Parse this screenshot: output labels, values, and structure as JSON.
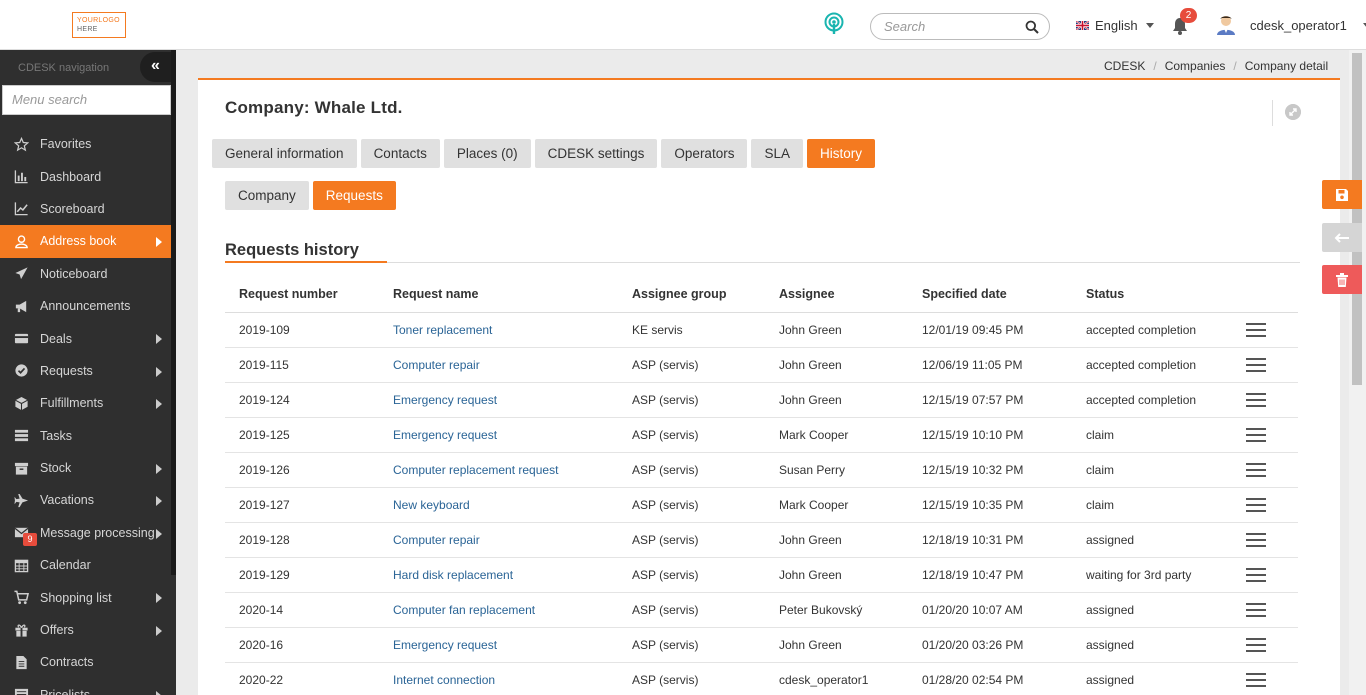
{
  "header": {
    "logo_line1": "YOURLOGO",
    "logo_line2": "HERE",
    "search_placeholder": "Search",
    "language": "English",
    "notifications_count": "2",
    "username": "cdesk_operator1"
  },
  "sidebar": {
    "title": "CDESK navigation",
    "collapse_icon": "«",
    "menu_search_placeholder": "Menu search",
    "items": [
      {
        "label": "Favorites",
        "icon": "star-icon",
        "arrow": false
      },
      {
        "label": "Dashboard",
        "icon": "bar-chart-icon",
        "arrow": false
      },
      {
        "label": "Scoreboard",
        "icon": "line-chart-icon",
        "arrow": false
      },
      {
        "label": "Address book",
        "icon": "user-icon",
        "arrow": true,
        "active": true
      },
      {
        "label": "Noticeboard",
        "icon": "paper-plane-icon",
        "arrow": false
      },
      {
        "label": "Announcements",
        "icon": "bullhorn-icon",
        "arrow": false
      },
      {
        "label": "Deals",
        "icon": "card-icon",
        "arrow": true
      },
      {
        "label": "Requests",
        "icon": "check-circle-icon",
        "arrow": true
      },
      {
        "label": "Fulfillments",
        "icon": "cube-icon",
        "arrow": true
      },
      {
        "label": "Tasks",
        "icon": "tasks-icon",
        "arrow": false
      },
      {
        "label": "Stock",
        "icon": "archive-icon",
        "arrow": true
      },
      {
        "label": "Vacations",
        "icon": "plane-icon",
        "arrow": true
      },
      {
        "label": "Message processing",
        "icon": "envelope-icon",
        "arrow": true,
        "badge": "9"
      },
      {
        "label": "Calendar",
        "icon": "calendar-icon",
        "arrow": false
      },
      {
        "label": "Shopping list",
        "icon": "cart-icon",
        "arrow": true
      },
      {
        "label": "Offers",
        "icon": "gift-icon",
        "arrow": true
      },
      {
        "label": "Contracts",
        "icon": "file-icon",
        "arrow": false
      },
      {
        "label": "Pricelists",
        "icon": "list-icon",
        "arrow": true
      }
    ]
  },
  "breadcrumb": [
    "CDESK",
    "Companies",
    "Company detail"
  ],
  "breadcrumb_sep": "/",
  "page": {
    "title": "Company: Whale Ltd.",
    "tabs": [
      "General information",
      "Contacts",
      "Places (0)",
      "CDESK settings",
      "Operators",
      "SLA",
      "History"
    ],
    "active_tab": "History",
    "subtabs": [
      "Company",
      "Requests"
    ],
    "active_subtab": "Requests",
    "section_title": "Requests history"
  },
  "table": {
    "headers": [
      "Request number",
      "Request name",
      "Assignee group",
      "Assignee",
      "Specified date",
      "Status"
    ],
    "rows": [
      [
        "2019-109",
        "Toner replacement",
        "KE servis",
        "John Green",
        "12/01/19 09:45 PM",
        "accepted completion"
      ],
      [
        "2019-115",
        "Computer repair",
        "ASP (servis)",
        "John Green",
        "12/06/19 11:05 PM",
        "accepted completion"
      ],
      [
        "2019-124",
        "Emergency request",
        "ASP (servis)",
        "John Green",
        "12/15/19 07:57 PM",
        "accepted completion"
      ],
      [
        "2019-125",
        "Emergency request",
        "ASP (servis)",
        "Mark Cooper",
        "12/15/19 10:10 PM",
        "claim"
      ],
      [
        "2019-126",
        "Computer replacement request",
        "ASP (servis)",
        "Susan Perry",
        "12/15/19 10:32 PM",
        "claim"
      ],
      [
        "2019-127",
        "New keyboard",
        "ASP (servis)",
        "Mark Cooper",
        "12/15/19 10:35 PM",
        "claim"
      ],
      [
        "2019-128",
        "Computer repair",
        "ASP (servis)",
        "John Green",
        "12/18/19 10:31 PM",
        "assigned"
      ],
      [
        "2019-129",
        "Hard disk replacement",
        "ASP (servis)",
        "John Green",
        "12/18/19 10:47 PM",
        "waiting for 3rd party"
      ],
      [
        "2020-14",
        "Computer fan replacement",
        "ASP (servis)",
        "Peter Bukovský",
        "01/20/20 10:07 AM",
        "assigned"
      ],
      [
        "2020-16",
        "Emergency request",
        "ASP (servis)",
        "John Green",
        "01/20/20 03:26 PM",
        "assigned"
      ],
      [
        "2020-22",
        "Internet connection",
        "ASP (servis)",
        "cdesk_operator1",
        "01/28/20 02:54 PM",
        "assigned"
      ]
    ]
  },
  "actions": {
    "save_icon": "save-icon",
    "back_icon": "arrow-left-icon",
    "delete_icon": "trash-icon"
  },
  "colors": {
    "accent": "#f47a20",
    "sidebar": "#2f2f2f",
    "link": "#2a6496",
    "danger": "#ee5a5a"
  }
}
